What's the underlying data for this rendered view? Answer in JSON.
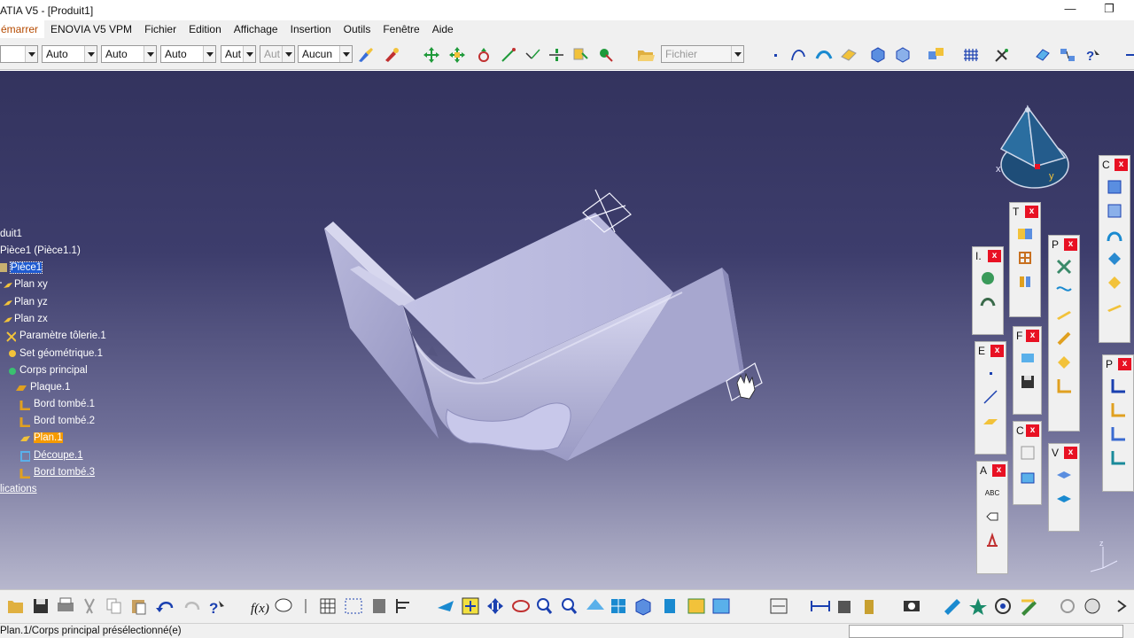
{
  "window": {
    "title": "ATIA V5 - [Produit1]",
    "minimize_glyph": "—",
    "restore_glyph": "❐"
  },
  "menu": {
    "items": [
      "émarrer",
      "ENOVIA V5 VPM",
      "Fichier",
      "Edition",
      "Affichage",
      "Insertion",
      "Outils",
      "Fenêtre",
      "Aide"
    ]
  },
  "toolbar": {
    "combos": [
      "",
      "Auto",
      "Auto",
      "Auto",
      "Aut",
      "Aut",
      "Aucun",
      "Fichier"
    ]
  },
  "tree": {
    "nodes": [
      {
        "label": "duit1"
      },
      {
        "label": "Pièce1 (Pièce1.1)"
      },
      {
        "label": "Pièce1"
      },
      {
        "label": "Plan xy"
      },
      {
        "label": "Plan yz"
      },
      {
        "label": "Plan zx"
      },
      {
        "label": "Paramètre tôlerie.1"
      },
      {
        "label": "Set géométrique.1"
      },
      {
        "label": "Corps principal"
      },
      {
        "label": "Plaque.1"
      },
      {
        "label": "Bord tombé.1"
      },
      {
        "label": "Bord tombé.2"
      },
      {
        "label": "Plan.1"
      },
      {
        "label": "Découpe.1"
      },
      {
        "label": "Bord tombé.3"
      },
      {
        "label": "lications"
      }
    ]
  },
  "compass": {
    "x_label": "x",
    "y_label": "y",
    "z_label": "z"
  },
  "axis_triad": {
    "z_label": "z"
  },
  "palettes": {
    "c1": {
      "letter": "C",
      "close": "x"
    },
    "t": {
      "letter": "T",
      "close": "x"
    },
    "p1": {
      "letter": "P",
      "close": "x"
    },
    "i": {
      "letter": "I.",
      "close": "x"
    },
    "f": {
      "letter": "F",
      "close": "x"
    },
    "e": {
      "letter": "E",
      "close": "x"
    },
    "c2": {
      "letter": "C",
      "close": "x"
    },
    "v": {
      "letter": "V",
      "close": "x"
    },
    "a": {
      "letter": "A",
      "close": "x",
      "abc": "ABC"
    },
    "p2": {
      "letter": "P",
      "close": "x"
    }
  },
  "status": {
    "message": "Plan.1/Corps principal présélectionné(e)"
  },
  "colors": {
    "accent_selection": "#1e5ad0",
    "highlight_orange": "#f59a00",
    "close_red": "#e81123"
  }
}
